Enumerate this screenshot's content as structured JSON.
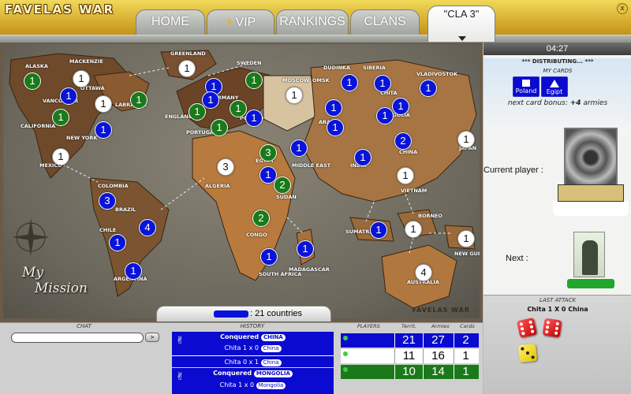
{
  "header": {
    "logo": "FAVELAS WAR",
    "tabs": [
      {
        "label": "HOME"
      },
      {
        "label": "VIP"
      },
      {
        "label": "RANKINGS"
      },
      {
        "label": "CLANS"
      }
    ],
    "active_tab": "\"CLA 3\"",
    "close_icon": "x"
  },
  "map": {
    "country_summary": ": 21 countries",
    "mission_line1": "My",
    "mission_line2": "Mission",
    "watermark": "FAVELAS WAR",
    "territory_labels": [
      "ALASKA",
      "MACKENZIE",
      "OTTAWA",
      "VANCOUVER",
      "LABRADOR",
      "CALIFORNIA",
      "NEW YORK",
      "MEXICO",
      "GREENLAND",
      "SWEDEN",
      "GERMANY",
      "ENGLAND",
      "PORTUGAL",
      "MOSCOW",
      "POLAND",
      "OMSK",
      "DUDINKA",
      "SIBERIA",
      "VLADIVOSTOK",
      "CHITA",
      "ARAL",
      "MONGOLIA",
      "CHINA",
      "JAPAN",
      "INDIA",
      "VIETNAM",
      "MIDDLE EAST",
      "EGYPT",
      "ALGERIA",
      "SUDAN",
      "CONGO",
      "SOUTH AFRICA",
      "MADAGASCAR",
      "COLOMBIA",
      "BRAZIL",
      "CHILE",
      "ARGENTINA",
      "BORNEO",
      "SUMATRA",
      "NEW GUINEA",
      "AUSTRALIA"
    ],
    "markers": [
      {
        "value": "1",
        "owner": "green"
      },
      {
        "value": "1",
        "owner": "white"
      },
      {
        "value": "1",
        "owner": "blue"
      },
      {
        "value": "1",
        "owner": "white"
      },
      {
        "value": "1",
        "owner": "green"
      },
      {
        "value": "1",
        "owner": "green"
      },
      {
        "value": "1",
        "owner": "blue"
      },
      {
        "value": "1",
        "owner": "white"
      },
      {
        "value": "1",
        "owner": "white"
      },
      {
        "value": "1",
        "owner": "blue"
      },
      {
        "value": "1",
        "owner": "green"
      },
      {
        "value": "1",
        "owner": "blue"
      },
      {
        "value": "1",
        "owner": "green"
      },
      {
        "value": "1",
        "owner": "green"
      },
      {
        "value": "1",
        "owner": "blue"
      },
      {
        "value": "1",
        "owner": "green"
      },
      {
        "value": "1",
        "owner": "white"
      },
      {
        "value": "1",
        "owner": "blue"
      },
      {
        "value": "1",
        "owner": "blue"
      },
      {
        "value": "1",
        "owner": "blue"
      },
      {
        "value": "1",
        "owner": "blue"
      },
      {
        "value": "1",
        "owner": "blue"
      },
      {
        "value": "1",
        "owner": "blue"
      },
      {
        "value": "1",
        "owner": "blue"
      },
      {
        "value": "1",
        "owner": "blue"
      },
      {
        "value": "2",
        "owner": "blue"
      },
      {
        "value": "1",
        "owner": "white"
      },
      {
        "value": "1",
        "owner": "blue"
      },
      {
        "value": "3",
        "owner": "green"
      },
      {
        "value": "3",
        "owner": "white"
      },
      {
        "value": "1",
        "owner": "blue"
      },
      {
        "value": "2",
        "owner": "green"
      },
      {
        "value": "1",
        "owner": "white"
      },
      {
        "value": "2",
        "owner": "green"
      },
      {
        "value": "1",
        "owner": "blue"
      },
      {
        "value": "1",
        "owner": "blue"
      },
      {
        "value": "3",
        "owner": "blue"
      },
      {
        "value": "4",
        "owner": "blue"
      },
      {
        "value": "1",
        "owner": "blue"
      },
      {
        "value": "1",
        "owner": "blue"
      },
      {
        "value": "1",
        "owner": "blue"
      },
      {
        "value": "1",
        "owner": "white"
      },
      {
        "value": "1",
        "owner": "white"
      },
      {
        "value": "4",
        "owner": "white"
      }
    ]
  },
  "right_panel": {
    "timer": "04:27",
    "distributing": "*** DISTRIBUTING... ***",
    "my_cards_label": "MY CARDS",
    "cards": [
      {
        "label": "Poland",
        "symbol": "square"
      },
      {
        "label": "Egipt",
        "symbol": "triangle"
      }
    ],
    "bonus_prefix": "next card bonus:",
    "bonus_value": "+4",
    "bonus_suffix": "armies",
    "current_player_label": "Current player :",
    "next_label": "Next :",
    "last_attack_title": "LAST ATTACK",
    "last_attack_result": "Chita 1 X 0 China",
    "dice": {
      "red": [
        6,
        6
      ],
      "yellow": [
        3
      ]
    }
  },
  "chat": {
    "title": "CHAT",
    "input_value": "",
    "send_label": ">"
  },
  "history": {
    "title": "HISTORY",
    "entries": [
      {
        "prefix": "Conquered",
        "territory": "CHINA",
        "lines": [
          {
            "text": "Chita  1 x 0",
            "pill": "China"
          },
          {
            "text": "Chita  0 x 1",
            "pill": "China"
          }
        ]
      },
      {
        "prefix": "Conquered",
        "territory": "MONGOLIA",
        "lines": [
          {
            "text": "Chita  1 x 0",
            "pill": "Mongolia"
          }
        ]
      }
    ]
  },
  "players": {
    "headers": [
      "PLAYERS",
      "Territ.",
      "Armies",
      "Cards"
    ],
    "rows": [
      {
        "territ": "21",
        "armies": "27",
        "cards": "2",
        "color": "#0a0ad0"
      },
      {
        "territ": "11",
        "armies": "16",
        "cards": "1",
        "color": "#ffffff"
      },
      {
        "territ": "10",
        "armies": "14",
        "cards": "1",
        "color": "#1a7a1a"
      }
    ]
  },
  "colors": {
    "blue_player": "#0a0ad0",
    "green_player": "#1a7a1a",
    "white_player": "#ffffff",
    "header_gold": "#d4a62a"
  }
}
